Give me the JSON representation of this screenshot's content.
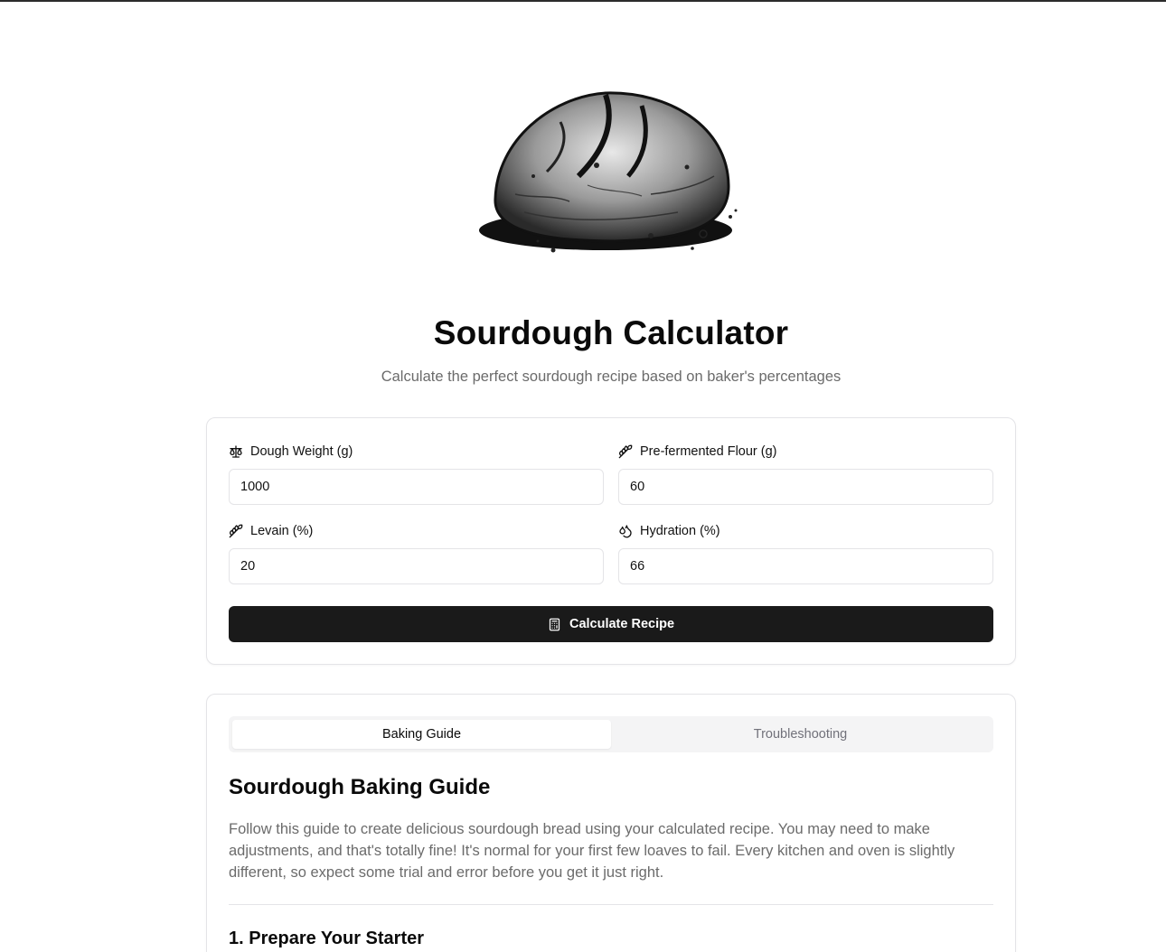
{
  "header": {
    "title": "Sourdough Calculator",
    "subtitle": "Calculate the perfect sourdough recipe based on baker's percentages",
    "hero_image": "bread-loaf-sketch"
  },
  "calculator": {
    "fields": [
      {
        "label": "Dough Weight (g)",
        "value": "1000",
        "icon": "scale-icon"
      },
      {
        "label": "Pre-fermented Flour (g)",
        "value": "60",
        "icon": "wheat-icon"
      },
      {
        "label": "Levain (%)",
        "value": "20",
        "icon": "wheat-icon"
      },
      {
        "label": "Hydration (%)",
        "value": "66",
        "icon": "droplets-icon"
      }
    ],
    "button_label": "Calculate Recipe",
    "button_icon": "calculator-icon"
  },
  "guide": {
    "tabs": [
      {
        "label": "Baking Guide",
        "active": true
      },
      {
        "label": "Troubleshooting",
        "active": false
      }
    ],
    "heading": "Sourdough Baking Guide",
    "intro": "Follow this guide to create delicious sourdough bread using your calculated recipe. You may need to make adjustments, and that's totally fine! It's normal for your first few loaves to fail. Every kitchen and oven is slightly different, so expect some trial and error before you get it just right.",
    "first_step": "1. Prepare Your Starter"
  },
  "colors": {
    "primary_button": "#1a1a1a",
    "muted_text": "#6b6b6b",
    "border": "#e4e4e7",
    "tab_background": "#f4f4f5"
  }
}
